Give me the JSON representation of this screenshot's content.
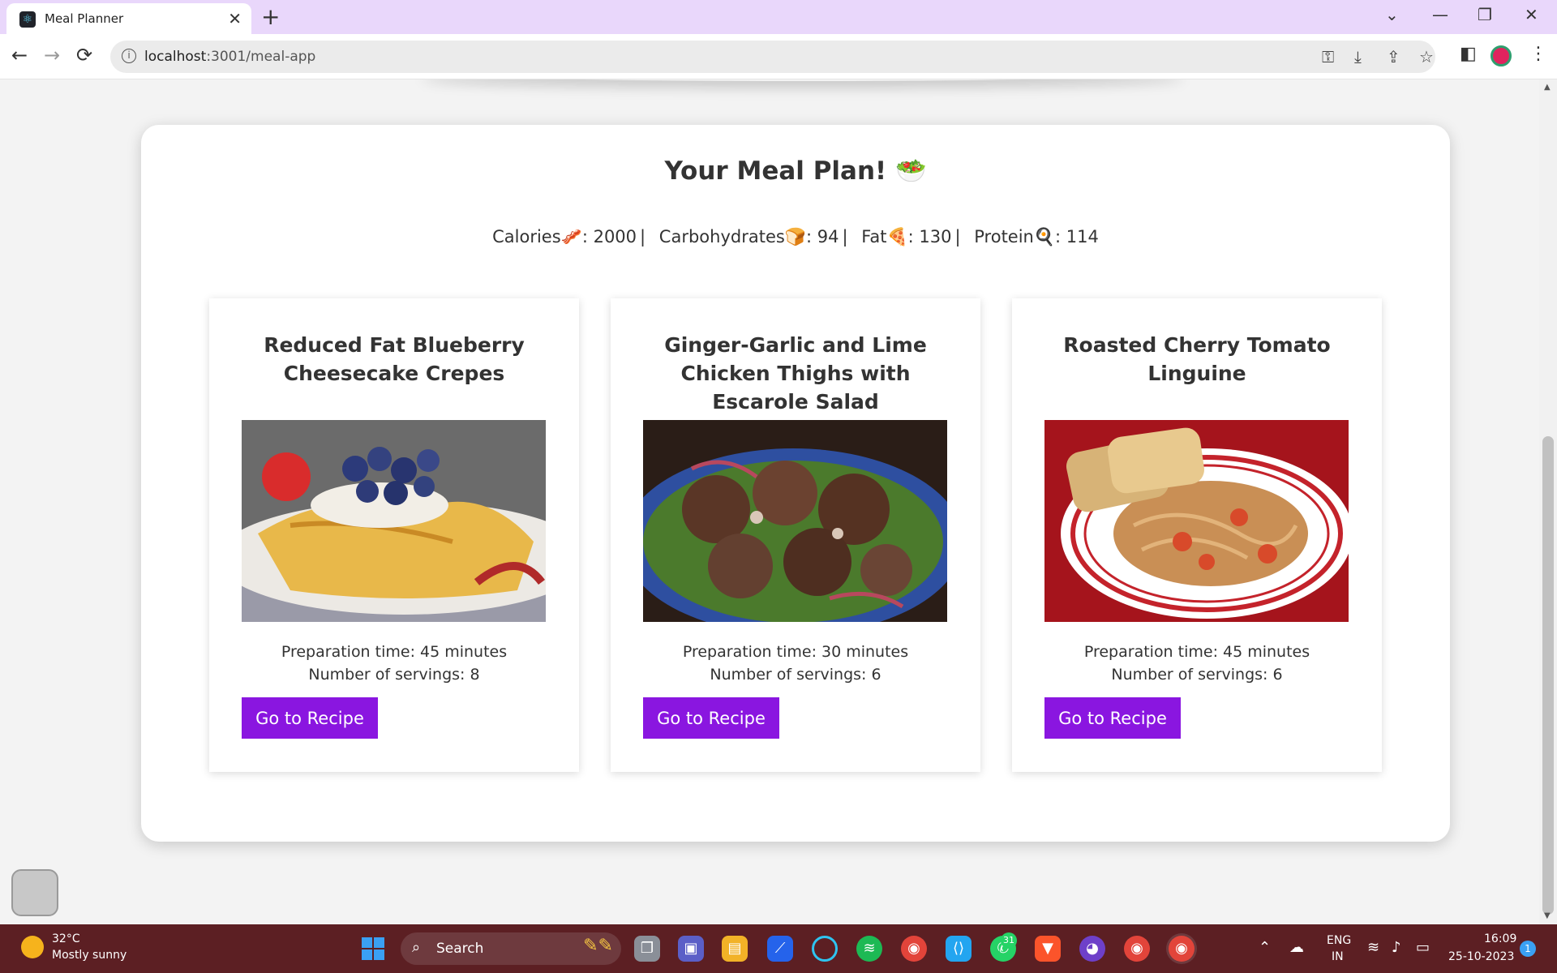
{
  "browser": {
    "tab_title": "Meal Planner",
    "tab_close": "✕",
    "new_tab": "+",
    "url_host": "localhost",
    "url_path": ":3001/meal-app",
    "window_controls": [
      "⌄",
      "—",
      "❐",
      "✕"
    ],
    "nav": {
      "back": "←",
      "forward": "→",
      "reload": "⟳"
    },
    "info": "i"
  },
  "page": {
    "title": "Your Meal Plan! 🥗",
    "nutrients": [
      {
        "label": "Calories🥓",
        "value": "2000"
      },
      {
        "label": "Carbohydrates🍞",
        "value": "94"
      },
      {
        "label": "Fat🍕",
        "value": "130"
      },
      {
        "label": "Protein🍳",
        "value": "114"
      }
    ],
    "meals": [
      {
        "title": "Reduced Fat Blueberry Cheesecake Crepes",
        "prep": "Preparation time: 45 minutes",
        "servings": "Number of servings: 8",
        "button": "Go to Recipe"
      },
      {
        "title": "Ginger-Garlic and Lime Chicken Thighs with Escarole Salad",
        "prep": "Preparation time: 30 minutes",
        "servings": "Number of servings: 6",
        "button": "Go to Recipe"
      },
      {
        "title": "Roasted Cherry Tomato Linguine",
        "prep": "Preparation time: 45 minutes",
        "servings": "Number of servings: 6",
        "button": "Go to Recipe"
      }
    ]
  },
  "taskbar": {
    "temperature": "32°C",
    "weather": "Mostly sunny",
    "search_label": "Search",
    "whatsapp_badge": "31",
    "lang_line1": "ENG",
    "lang_line2": "IN",
    "time": "16:09",
    "date": "25-10-2023",
    "notifications": "1"
  },
  "colors": {
    "accent_button": "#8a16e0",
    "tab_bar": "#e9d7fb",
    "taskbar": "#5c1f23"
  }
}
